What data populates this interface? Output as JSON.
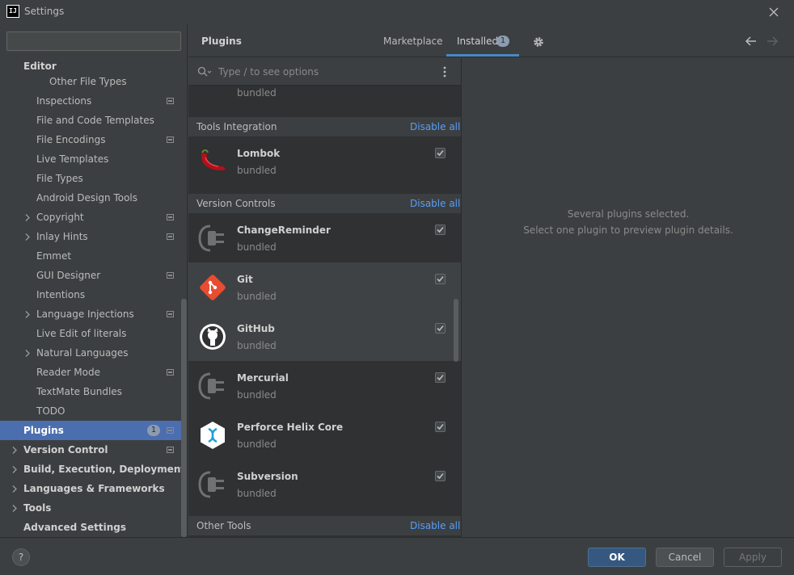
{
  "window": {
    "title": "Settings",
    "app_icon": "IJ"
  },
  "sidebar": {
    "search_placeholder": "",
    "items": [
      {
        "label": "Editor",
        "bold": true
      },
      {
        "label": "Other File Types"
      },
      {
        "label": "Inspections",
        "marker": true
      },
      {
        "label": "File and Code Templates"
      },
      {
        "label": "File Encodings",
        "marker": true
      },
      {
        "label": "Live Templates"
      },
      {
        "label": "File Types"
      },
      {
        "label": "Android Design Tools"
      },
      {
        "label": "Copyright",
        "marker": true,
        "arrow": true
      },
      {
        "label": "Inlay Hints",
        "marker": true,
        "arrow": true
      },
      {
        "label": "Emmet"
      },
      {
        "label": "GUI Designer",
        "marker": true
      },
      {
        "label": "Intentions"
      },
      {
        "label": "Language Injections",
        "marker": true,
        "arrow": true
      },
      {
        "label": "Live Edit of literals"
      },
      {
        "label": "Natural Languages",
        "arrow": true
      },
      {
        "label": "Reader Mode",
        "marker": true
      },
      {
        "label": "TextMate Bundles"
      },
      {
        "label": "TODO"
      },
      {
        "label": "Plugins",
        "selected": true,
        "badge": "1",
        "marker": true
      },
      {
        "label": "Version Control",
        "marker": true,
        "arrow": true
      },
      {
        "label": "Build, Execution, Deployment",
        "arrow": true
      },
      {
        "label": "Languages & Frameworks",
        "arrow": true
      },
      {
        "label": "Tools",
        "arrow": true
      },
      {
        "label": "Advanced Settings"
      }
    ]
  },
  "plugins_header": {
    "title": "Plugins",
    "tab_marketplace": "Marketplace",
    "tab_installed": "Installed",
    "installed_badge": "1"
  },
  "plugin_list": {
    "search_placeholder": "Type / to see options",
    "top_partial_version": "bundled",
    "groups": {
      "tools_integration": {
        "name": "Tools Integration",
        "disable_all": "Disable all"
      },
      "version_controls": {
        "name": "Version Controls",
        "disable_all": "Disable all"
      },
      "other_tools": {
        "name": "Other Tools",
        "disable_all": "Disable all"
      }
    },
    "plugins": {
      "lombok": {
        "name": "Lombok",
        "version": "bundled"
      },
      "changereminder": {
        "name": "ChangeReminder",
        "version": "bundled"
      },
      "git": {
        "name": "Git",
        "version": "bundled"
      },
      "github": {
        "name": "GitHub",
        "version": "bundled"
      },
      "mercurial": {
        "name": "Mercurial",
        "version": "bundled"
      },
      "perforce": {
        "name": "Perforce Helix Core",
        "version": "bundled"
      },
      "subversion": {
        "name": "Subversion",
        "version": "bundled"
      }
    }
  },
  "detail": {
    "line1": "Several plugins selected.",
    "line2": "Select one plugin to preview plugin details."
  },
  "footer": {
    "help": "?",
    "ok": "OK",
    "cancel": "Cancel",
    "apply": "Apply"
  },
  "colors": {
    "background": "#3c3f41",
    "list_background": "#2f3133",
    "selection": "#4b6eaf",
    "link": "#589df6",
    "tab_underline": "#4a88c7"
  }
}
